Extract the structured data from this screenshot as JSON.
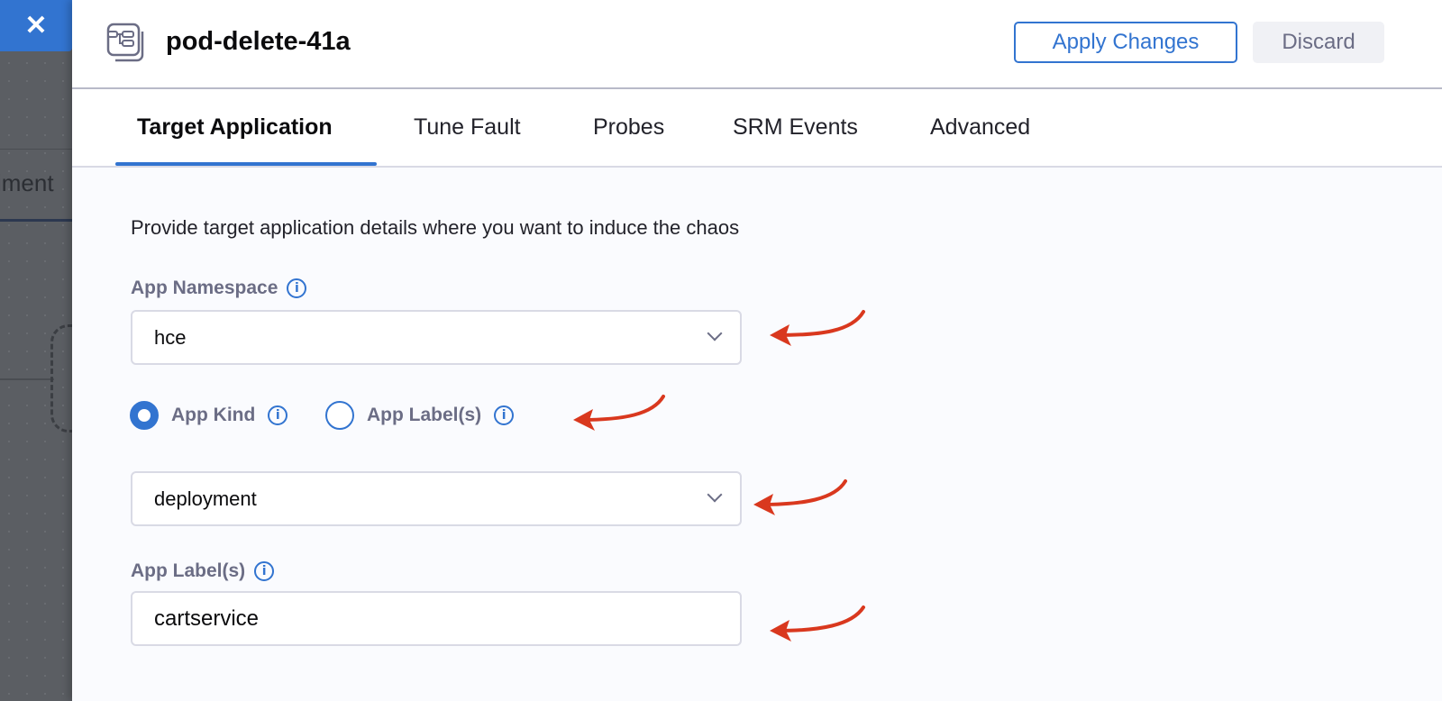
{
  "background": {
    "close_icon": "close-icon",
    "partial_tab": "iment"
  },
  "header": {
    "title": "pod-delete-41a",
    "icon": "fault-node-icon",
    "apply_label": "Apply Changes",
    "discard_label": "Discard"
  },
  "tabs": [
    {
      "label": "Target Application",
      "active": true
    },
    {
      "label": "Tune Fault"
    },
    {
      "label": "Probes"
    },
    {
      "label": "SRM Events"
    },
    {
      "label": "Advanced"
    }
  ],
  "form": {
    "description": "Provide target application details where you want to induce the chaos",
    "namespace_label": "App Namespace",
    "namespace_value": "hce",
    "radio_kind": "App Kind",
    "radio_labels": "App Label(s)",
    "selected": "App Kind",
    "kind_value": "deployment",
    "labels_label": "App Label(s)",
    "labels_value": "cartservice"
  },
  "colors": {
    "accent": "#3274d0",
    "annotation_arrow": "#d9381e"
  }
}
